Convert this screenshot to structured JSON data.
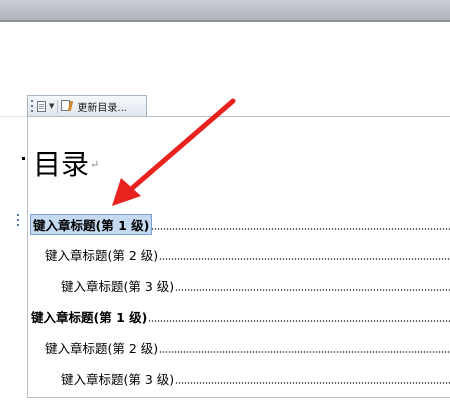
{
  "toolbar": {
    "update_label": "更新目录..."
  },
  "document": {
    "toc_title": "目录",
    "entries": [
      {
        "text": "键入章标题(第 1 级)",
        "level": 1,
        "selected": true
      },
      {
        "text": "键入章标题(第 2 级)",
        "level": 2,
        "selected": false
      },
      {
        "text": "键入章标题(第 3 级)",
        "level": 3,
        "selected": false
      },
      {
        "text": "键入章标题(第 1 级)",
        "level": 1,
        "selected": false
      },
      {
        "text": "键入章标题(第 2 级)",
        "level": 2,
        "selected": false
      },
      {
        "text": "键入章标题(第 3 级)",
        "level": 3,
        "selected": false
      }
    ]
  },
  "annotation": {
    "arrow_color": "#e8231f"
  }
}
